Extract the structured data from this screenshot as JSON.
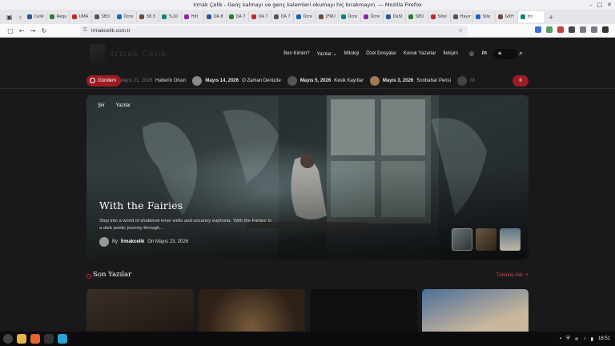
{
  "window": {
    "title": "Irmak Çelik - Genç kalmayı ve genç kalemleri okumayı hiç bırakmayın. — Mozilla Firefox"
  },
  "tabs": [
    {
      "label": "Celik"
    },
    {
      "label": "Requ"
    },
    {
      "label": "UMA"
    },
    {
      "label": "SEO"
    },
    {
      "label": "Ücre"
    },
    {
      "label": "38.3"
    },
    {
      "label": "%10"
    },
    {
      "label": "Hitl"
    },
    {
      "label": "DA 8"
    },
    {
      "label": "DA 7"
    },
    {
      "label": "DA 7"
    },
    {
      "label": "DA 7"
    },
    {
      "label": "Ücre"
    },
    {
      "label": "[FRU"
    },
    {
      "label": "Ücre"
    },
    {
      "label": "Ücre"
    },
    {
      "label": "DaSt"
    },
    {
      "label": "SEO"
    },
    {
      "label": "Sitel"
    },
    {
      "label": "Hayır"
    },
    {
      "label": "Site"
    },
    {
      "label": "GitH"
    },
    {
      "label": "Irn"
    }
  ],
  "address": {
    "url": "irmakcelik.com.tr"
  },
  "site": {
    "logo_text": "Irmak Çelik",
    "menu": [
      "Ben Kimim?",
      "Yazılar",
      "Mitoloji",
      "Özel Dosyalar",
      "Konuk Yazarlar",
      "İletişim"
    ],
    "social": {
      "instagram": "◎",
      "linkedin": "in"
    },
    "theme_toggle_icon": "☀"
  },
  "ticker": {
    "badge": "Gündem",
    "items": [
      {
        "date": "Mayıs 21, 2026",
        "title": "Haberin Olsun"
      },
      {
        "date": "Mayıs 14, 2026",
        "title": "O Zaman Denizde"
      },
      {
        "date": "Mayıs 5, 2026",
        "title": "Kesik Kayıtlar"
      },
      {
        "date": "Mayıs 3, 2026",
        "title": "Sonbahar Perisi"
      },
      {
        "date": "Mi",
        "title": ""
      }
    ],
    "pause_icon": "II"
  },
  "hero": {
    "tags": [
      "Şiir",
      "Yazılar"
    ],
    "title": "With the Fairies",
    "description": "Step into a world of shattered inner wells and uncanny euphoria. 'With the Fairies' is a dark poetic journey through...",
    "by": "By",
    "author": "İrmakcelik",
    "date": "On Mayıs 23, 2026"
  },
  "section": {
    "title": "Son Yazılar",
    "link": "Tümünü Gör ↗"
  },
  "taskbar": {
    "time": "18:51"
  },
  "colors": {
    "accent": "#9e1b22",
    "bg": "#19191b",
    "text": "#ffffff"
  }
}
